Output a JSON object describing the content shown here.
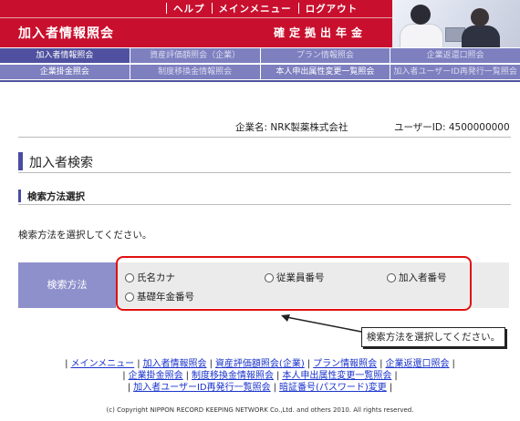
{
  "header": {
    "nav": [
      "ヘルプ",
      "メインメニュー",
      "ログアウト"
    ],
    "app_title": "加入者情報照会",
    "pension_label": "確定拠出年金"
  },
  "menu_row1": [
    {
      "label": "加入者情報照会",
      "state": "active"
    },
    {
      "label": "資産評価額照会（企業）",
      "state": "dim"
    },
    {
      "label": "プラン情報照会",
      "state": "dim"
    },
    {
      "label": "企業返還口照会",
      "state": "dim"
    }
  ],
  "menu_row2": [
    {
      "label": "企業掛金照会",
      "state": "normal"
    },
    {
      "label": "制度移換金情報照会",
      "state": "dim"
    },
    {
      "label": "本人申出属性変更一覧照会",
      "state": "normal"
    },
    {
      "label": "加入者ユーザーID再発行一覧照会",
      "state": "dim"
    }
  ],
  "info": {
    "company_label": "企業名:",
    "company_name": "NRK製薬株式会社",
    "user_label": "ユーザーID:",
    "user_id": "4500000000"
  },
  "page_title": "加入者検索",
  "section_title": "検索方法選択",
  "instruction": "検索方法を選択してください。",
  "search": {
    "label": "検索方法",
    "options": [
      "氏名カナ",
      "従業員番号",
      "加入者番号",
      "基礎年金番号"
    ]
  },
  "callout": "検索方法を選択してください。",
  "footer": {
    "row1": [
      "メインメニュー",
      "加入者情報照会",
      "資産評価額照会(企業)",
      "プラン情報照会",
      "企業返還口照会"
    ],
    "row2": [
      "企業掛金照会",
      "制度移換金情報照会",
      "本人申出属性変更一覧照会"
    ],
    "row3": [
      "加入者ユーザーID再発行一覧照会",
      "暗証番号(パスワード)変更"
    ],
    "copyright": "(c) Copyright NIPPON RECORD KEEPING NETWORK Co.,Ltd. and others 2010. All rights reserved."
  },
  "colors": {
    "brand_red": "#c8102e",
    "menu_purple": "#7d7fbf",
    "menu_active": "#4f51a0",
    "label_purple": "#8e90cc",
    "highlight_red": "#e01010",
    "link_blue": "#1a33cc"
  }
}
